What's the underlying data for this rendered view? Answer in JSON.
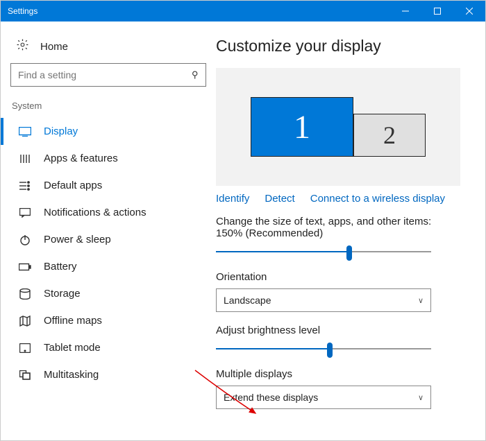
{
  "window": {
    "title": "Settings"
  },
  "sidebar": {
    "home": "Home",
    "search_placeholder": "Find a setting",
    "group": "System",
    "items": [
      {
        "label": "Display"
      },
      {
        "label": "Apps & features"
      },
      {
        "label": "Default apps"
      },
      {
        "label": "Notifications & actions"
      },
      {
        "label": "Power & sleep"
      },
      {
        "label": "Battery"
      },
      {
        "label": "Storage"
      },
      {
        "label": "Offline maps"
      },
      {
        "label": "Tablet mode"
      },
      {
        "label": "Multitasking"
      }
    ]
  },
  "main": {
    "heading": "Customize your display",
    "monitor1": "1",
    "monitor2": "2",
    "links": {
      "identify": "Identify",
      "detect": "Detect",
      "wireless": "Connect to a wireless display"
    },
    "scale_label": "Change the size of text, apps, and other items: 150% (Recommended)",
    "scale_value_pct": 62,
    "orientation_label": "Orientation",
    "orientation_value": "Landscape",
    "brightness_label": "Adjust brightness level",
    "brightness_value_pct": 53,
    "multiple_label": "Multiple displays",
    "multiple_value": "Extend these displays"
  }
}
